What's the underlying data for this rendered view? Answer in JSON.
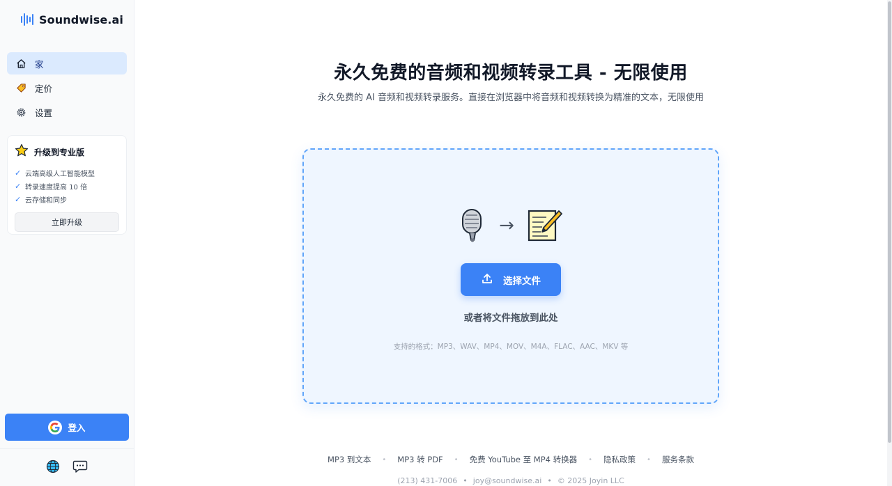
{
  "brand": {
    "name": "Soundwise.ai",
    "accent": "#3b82f6"
  },
  "nav": {
    "items": [
      {
        "label": "家",
        "icon": "home-icon",
        "active": true
      },
      {
        "label": "定价",
        "icon": "price-tag-icon",
        "active": false
      },
      {
        "label": "设置",
        "icon": "gear-icon",
        "active": false
      }
    ]
  },
  "upgrade": {
    "title": "升级到专业版",
    "icon": "star-icon",
    "features": [
      "云端高级人工智能模型",
      "转录速度提高 10 倍",
      "云存储和同步"
    ],
    "button_label": "立即升级"
  },
  "login": {
    "label": "登入",
    "icon": "google-icon"
  },
  "sidebar_bottom": {
    "icons": [
      "globe-icon",
      "chat-icon"
    ]
  },
  "main": {
    "title": "永久免费的音频和视频转录工具 - 无限使用",
    "subtitle": "永久免费的 AI 音频和视频转录服务。直接在浏览器中将音频和视频转换为精准的文本，无限使用"
  },
  "dropzone": {
    "icons": [
      "microphone-icon",
      "arrow-right-icon",
      "memo-icon"
    ],
    "arrow": "→",
    "button_label": "选择文件",
    "button_icon": "upload-icon",
    "hint": "或者将文件拖放到此处",
    "formats": "支持的格式：MP3、WAV、MP4、MOV、M4A、FLAC、AAC、MKV 等"
  },
  "footer": {
    "links": [
      "MP3 到文本",
      "MP3 转 PDF",
      "免费 YouTube 至 MP4 转换器",
      "隐私政策",
      "服务条款"
    ],
    "separator": "•",
    "phone": "(213) 431-7006",
    "email": "joy@soundwise.ai",
    "copyright": "© 2025 Joyin LLC"
  }
}
